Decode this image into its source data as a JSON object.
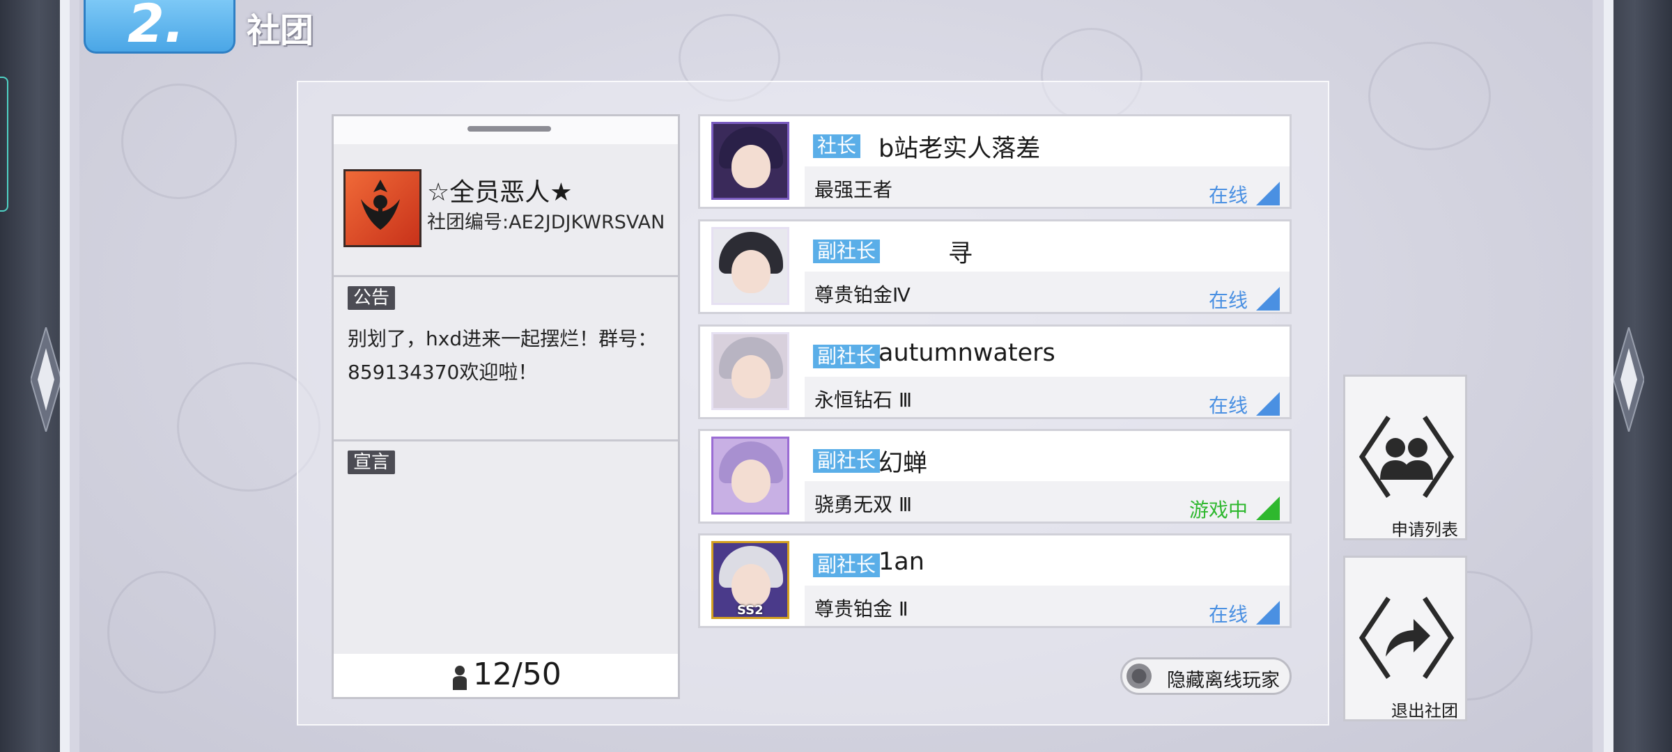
{
  "header": {
    "number": "2.",
    "title": "社团"
  },
  "club": {
    "name": "☆全员恶人★",
    "id_label": "社团编号:AE2JDJKWRSVAN",
    "notice_tag": "公告",
    "notice_text": "别划了，hxd进来一起摆烂！群号：859134370欢迎啦！",
    "declaration_tag": "宣言",
    "declaration_text": "",
    "member_count": "12/50"
  },
  "members": [
    {
      "role": "社长",
      "name": "b站老实人落差",
      "rank": "最强王者",
      "status": "在线",
      "status_color": "#4a90e2",
      "avatar_icon": "purple-hair-avatar"
    },
    {
      "role": "副社长",
      "name": "寻",
      "rank": "尊贵铂金Ⅳ",
      "status": "在线",
      "status_color": "#4a90e2",
      "avatar_icon": "dark-hair-avatar"
    },
    {
      "role": "副社长",
      "name": "autumnwaters",
      "rank": "永恒钻石 Ⅲ",
      "status": "在线",
      "status_color": "#4a90e2",
      "avatar_icon": "silver-hair-avatar"
    },
    {
      "role": "副社长",
      "name": "幻蝉",
      "rank": "骁勇无双 Ⅲ",
      "status": "游戏中",
      "status_color": "#2eb82e",
      "avatar_icon": "lavender-hair-avatar"
    },
    {
      "role": "副社长",
      "name": "1an",
      "rank": "尊贵铂金 Ⅱ",
      "status": "在线",
      "status_color": "#4a90e2",
      "avatar_icon": "white-hair-avatar",
      "avatar_badge": "SS2"
    }
  ],
  "hide_offline_label": "隐藏离线玩家",
  "side_buttons": {
    "applications": "申请列表",
    "leave": "退出社团"
  },
  "colors": {
    "accent": "#5aaee8",
    "online": "#4a90e2",
    "in_game": "#2eb82e"
  }
}
